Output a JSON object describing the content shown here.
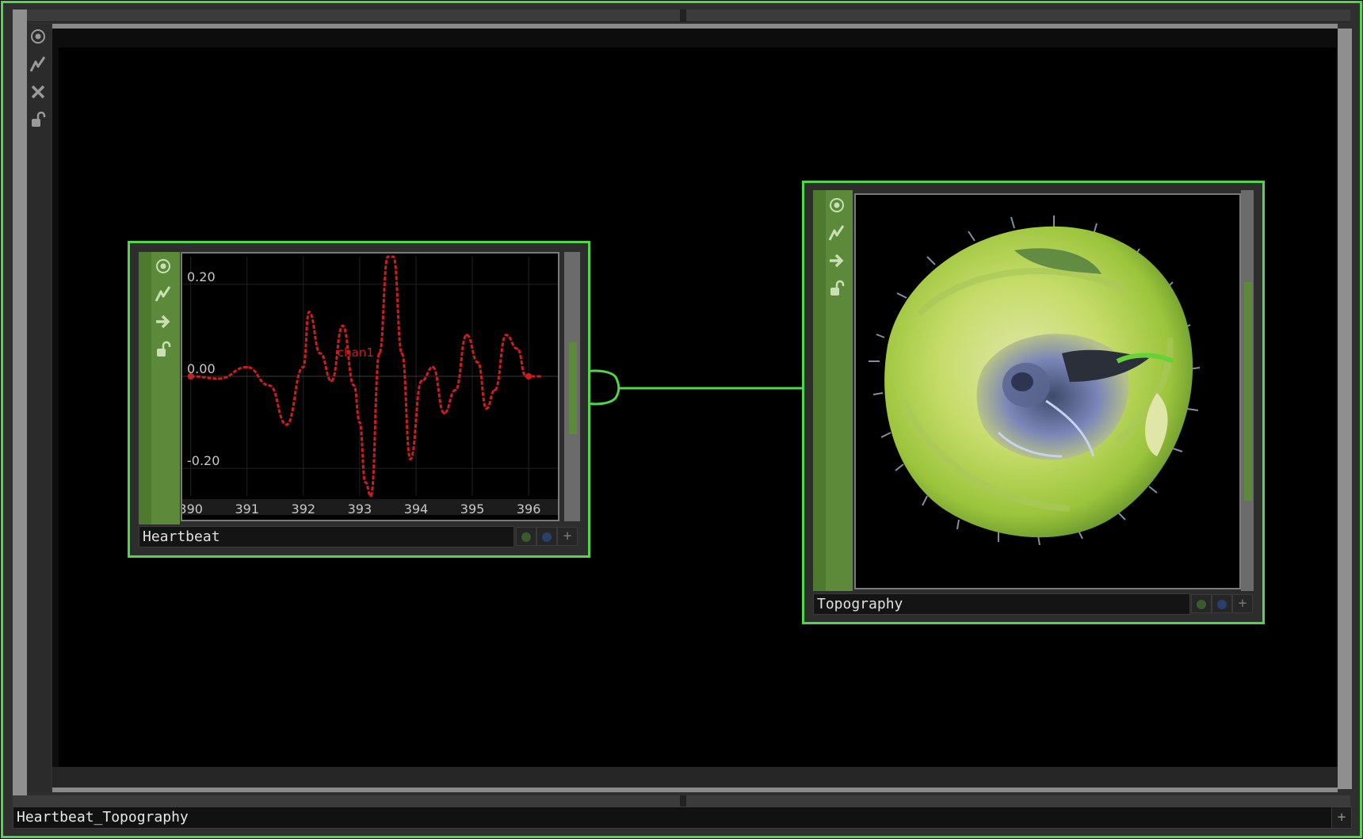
{
  "network": {
    "component_name": "Heartbeat_Topography",
    "add_glyph": "+"
  },
  "colors": {
    "accent_green": "#4fd64a",
    "strip_green": "#5c8a3a",
    "curve_red": "#cc1e1e"
  },
  "side_toolbar": {
    "icons": [
      "viewer-icon",
      "bypass-icon",
      "close-icon",
      "lock-icon"
    ]
  },
  "nodes": {
    "heartbeat": {
      "name": "Heartbeat",
      "icons": [
        "viewer-icon",
        "bypass-icon",
        "export-icon",
        "lock-icon"
      ],
      "flags": [
        "+"
      ]
    },
    "topography": {
      "name": "Topography",
      "icons": [
        "viewer-icon",
        "bypass-icon",
        "export-icon",
        "lock-icon"
      ],
      "flags": [
        "+"
      ]
    }
  },
  "chart_data": {
    "type": "line",
    "series": [
      {
        "name": "chan1",
        "x": [
          390.0,
          390.5,
          391.0,
          391.4,
          391.7,
          392.0,
          392.1,
          392.3,
          392.5,
          392.7,
          392.9,
          393.0,
          393.1,
          393.2,
          393.35,
          393.5,
          393.6,
          393.75,
          393.9,
          394.1,
          394.3,
          394.5,
          394.7,
          394.9,
          395.1,
          395.25,
          395.4,
          395.6,
          395.8,
          395.95,
          396.0,
          396.2
        ],
        "y": [
          0.0,
          -0.005,
          0.02,
          -0.02,
          -0.105,
          0.02,
          0.14,
          0.05,
          -0.01,
          0.11,
          -0.02,
          -0.1,
          -0.23,
          -0.26,
          0.05,
          0.26,
          0.26,
          0.05,
          -0.18,
          -0.01,
          0.02,
          -0.08,
          -0.03,
          0.09,
          0.03,
          -0.07,
          -0.03,
          0.09,
          0.06,
          0.0,
          0.0,
          0.0
        ]
      }
    ],
    "ytick_labels": [
      "0.20",
      "0.00",
      "-0.20"
    ],
    "yticks": [
      0.2,
      0.0,
      -0.2
    ],
    "xticks": [
      390,
      391,
      392,
      393,
      394,
      395,
      396
    ],
    "xtick_labels": [
      "390",
      "391",
      "392",
      "393",
      "394",
      "395",
      "396"
    ],
    "xlim": [
      389.85,
      396.35
    ],
    "ylim": [
      -0.26,
      0.26
    ],
    "grid": true
  }
}
